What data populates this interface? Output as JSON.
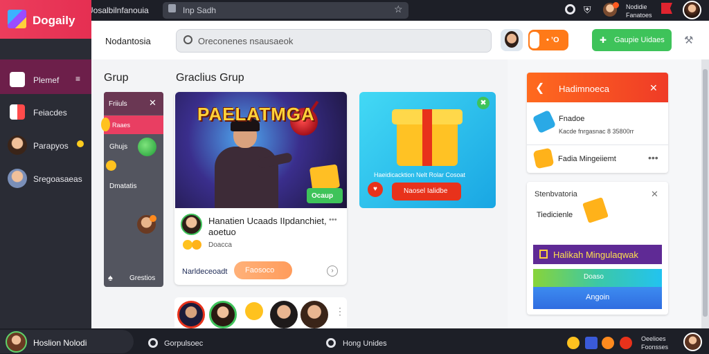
{
  "topbar": {
    "title": "Uosalbilnfanouia",
    "url": "Inp Sadh",
    "notif_line1": "Nodidie",
    "notif_line2": "Fanatoes"
  },
  "brand": {
    "name": "Dogaily"
  },
  "sidebar": {
    "items": [
      {
        "label": "Plemef",
        "icon": "square-icon"
      },
      {
        "label": "Feiacdes",
        "icon": "chart-icon"
      },
      {
        "label": "Parapyos",
        "icon": "avatar"
      },
      {
        "label": "Sregoasaeas",
        "icon": "avatar"
      }
    ]
  },
  "header": {
    "title": "Nodantosia",
    "search_placeholder": "Oreconenes nsausaeok",
    "toggle_label": "• ’O",
    "action_label": "Gaupie Uidaes"
  },
  "main": {
    "grup_title": "Grup",
    "gallery_title": "Graclius Grup",
    "grup_panel": {
      "title": "Friiuls",
      "active": "Raaes",
      "item2": "Ghujs",
      "item3": "Dmatatis",
      "footer": "Grestios"
    },
    "game_card": {
      "banner": "PAELATMGA",
      "tag": "Ocaup",
      "post_title": "Hanatien Ucaads IIpdanchiet, aoetuo",
      "post_more": "•••",
      "post_sub": "Doacca",
      "link": "Narldeceoadt",
      "button": "Faosoco"
    },
    "gift_card": {
      "text": "Haeidicacktion Nelt Rolar Cosoat",
      "button": "Naosel Ialidbe",
      "badge": "♥",
      "close": "✖"
    }
  },
  "right": {
    "notification": {
      "title": "Hadimnoeca",
      "row1_title": "Fnadoe",
      "row1_sub": "Kacde fnrgasnac 8 35800rr",
      "row2_title": "Fadia Mingeiiemt",
      "row2_more": "•••"
    },
    "offer": {
      "title": "Stenbvatoria",
      "subtitle": "Tiedicienle",
      "bar1": "Halikah Mingulaqwak",
      "bar2": "Doaso",
      "bar3": "Angoin"
    }
  },
  "bottombar": {
    "user": "Hoslion Nolodi",
    "item1": "Gorpulsoec",
    "item2": "Hong Unides",
    "time_line1": "Oeelioes",
    "time_line2": "Foonsses"
  }
}
